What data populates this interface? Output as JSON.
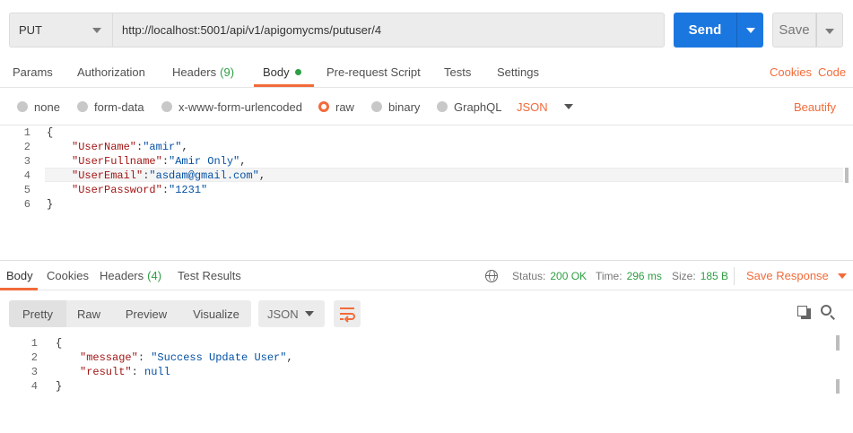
{
  "request": {
    "method": "PUT",
    "url": "http://localhost:5001/api/v1/apigomycms/putuser/4",
    "send_label": "Send",
    "save_label": "Save"
  },
  "request_tabs": [
    {
      "label": "Params"
    },
    {
      "label": "Authorization"
    },
    {
      "label": "Headers",
      "count": "(9)"
    },
    {
      "label": "Body",
      "active": true
    },
    {
      "label": "Pre-request Script"
    },
    {
      "label": "Tests"
    },
    {
      "label": "Settings"
    }
  ],
  "request_links": {
    "cookies": "Cookies",
    "code": "Code"
  },
  "body_types": [
    {
      "label": "none"
    },
    {
      "label": "form-data"
    },
    {
      "label": "x-www-form-urlencoded"
    },
    {
      "label": "raw",
      "selected": true
    },
    {
      "label": "binary"
    },
    {
      "label": "GraphQL"
    }
  ],
  "body_format": "JSON",
  "beautify_label": "Beautify",
  "request_body_lines": [
    {
      "n": "1",
      "text": "{"
    },
    {
      "n": "2",
      "key": "\"UserName\"",
      "value": "\"amir\"",
      "trail": ","
    },
    {
      "n": "3",
      "key": "\"UserFullname\"",
      "value": "\"Amir Only\"",
      "trail": ","
    },
    {
      "n": "4",
      "key": "\"UserEmail\"",
      "value": "\"asdam@gmail.com\"",
      "trail": ","
    },
    {
      "n": "5",
      "key": "\"UserPassword\"",
      "value": "\"1231\"",
      "trail": ""
    },
    {
      "n": "6",
      "text": "}"
    }
  ],
  "response_tabs": [
    {
      "label": "Body",
      "active": true
    },
    {
      "label": "Cookies"
    },
    {
      "label": "Headers",
      "count": "(4)"
    },
    {
      "label": "Test Results"
    }
  ],
  "response_meta": {
    "status_label": "Status:",
    "status_value": "200 OK",
    "time_label": "Time:",
    "time_value": "296 ms",
    "size_label": "Size:",
    "size_value": "185 B"
  },
  "save_response_label": "Save Response",
  "view_modes": [
    {
      "label": "Pretty",
      "active": true
    },
    {
      "label": "Raw"
    },
    {
      "label": "Preview"
    },
    {
      "label": "Visualize"
    }
  ],
  "response_format": "JSON",
  "response_body_lines": [
    {
      "n": "1",
      "text": "{"
    },
    {
      "n": "2",
      "key": "\"message\"",
      "value": "\"Success Update User\"",
      "trail": ","
    },
    {
      "n": "3",
      "key": "\"result\"",
      "value": "null",
      "trail": ""
    },
    {
      "n": "4",
      "text": "}"
    }
  ],
  "icons": {
    "method_dropdown": "chevron-down-icon",
    "globe": "globe-icon",
    "wrap": "wrap-lines-icon",
    "copy": "copy-icon",
    "search": "search-icon"
  },
  "colors": {
    "accent": "#f26b3a",
    "send": "#1b77e0",
    "success": "#2e9e45"
  }
}
